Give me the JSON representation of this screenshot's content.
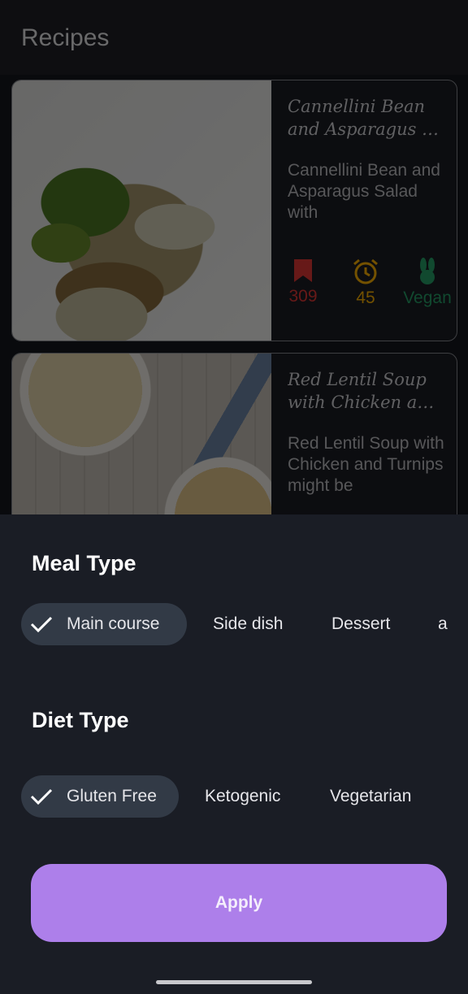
{
  "app": {
    "title": "Recipes"
  },
  "recipes": [
    {
      "title_line1": "Cannellini Bean",
      "title_line2": "and Asparagus S...",
      "desc": "Cannellini Bean and Asparagus Salad with",
      "likes": "309",
      "minutes": "45",
      "tag": "Vegan"
    },
    {
      "title_line1": "Red Lentil Soup",
      "title_line2": "with Chicken and...",
      "desc": "Red Lentil Soup with Chicken and Turnips might be"
    }
  ],
  "sheet": {
    "meal_type": {
      "title": "Meal Type",
      "chips": [
        "Main course",
        "Side dish",
        "Dessert",
        "a"
      ],
      "selected": "Main course"
    },
    "diet_type": {
      "title": "Diet Type",
      "chips": [
        "Gluten Free",
        "Ketogenic",
        "Vegetarian"
      ],
      "selected": "Gluten Free"
    },
    "apply_label": "Apply"
  },
  "colors": {
    "accent": "#ad7fea",
    "chip_selected": "#323a46",
    "likes": "#e53935",
    "time": "#ffb300",
    "vegan": "#26a269"
  },
  "icons": [
    "bookmark-icon",
    "alarm-clock-icon",
    "rabbit-icon",
    "check-icon"
  ]
}
